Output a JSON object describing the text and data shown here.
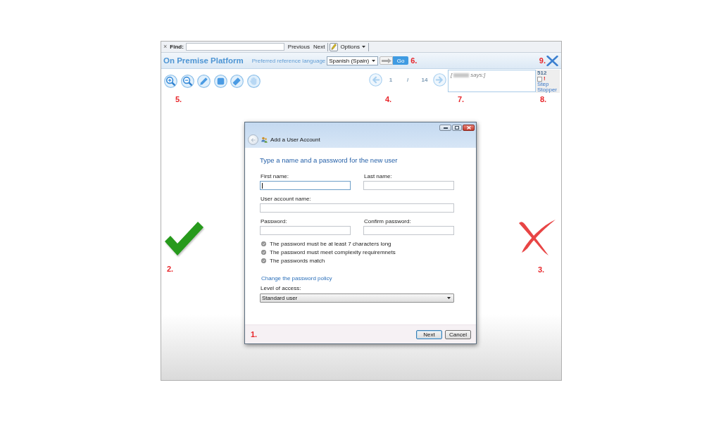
{
  "find_bar": {
    "close": "×",
    "label": "Find:",
    "previous": "Previous",
    "next": "Next",
    "options": "Options"
  },
  "header": {
    "title": "On Premise Platform",
    "language_label": "Preferred reference language",
    "language": "Spanish (Spain)",
    "go": "Go",
    "go_marker": "6.",
    "close_marker": "9."
  },
  "toolbar": {
    "marker": "5."
  },
  "pager": {
    "current": "1",
    "separator": "/",
    "total": "14",
    "marker": "4."
  },
  "note": {
    "open": "[",
    "close": "says:]",
    "marker": "7."
  },
  "step_panel": {
    "count": "512",
    "checked": false,
    "alert": "!",
    "link": "Step Stopper",
    "marker": "8."
  },
  "correct": {
    "marker": "2."
  },
  "incorrect": {
    "marker": "3."
  },
  "dialog": {
    "title": "Add a User Account",
    "heading": "Type a name and a password for the new user",
    "field_rows": [
      [
        {
          "label": "First name:",
          "focused": true
        },
        {
          "label": "Last name:",
          "focused": false
        }
      ],
      [
        {
          "label": "User account name:",
          "focused": false
        }
      ],
      [
        {
          "label": "Password:",
          "focused": false
        },
        {
          "label": "Confirm password:",
          "focused": false
        }
      ]
    ],
    "requirements": [
      "The password must be at least 7 characters long",
      "The password must meet complexity requiremnets",
      "The passwords match"
    ],
    "link": "Change the password policy",
    "access_label": "Level of access:",
    "access_value": "Standard user",
    "marker": "1.",
    "buttons": [
      {
        "label": "Next",
        "default": true
      },
      {
        "label": "Cancel",
        "default": false
      }
    ]
  }
}
